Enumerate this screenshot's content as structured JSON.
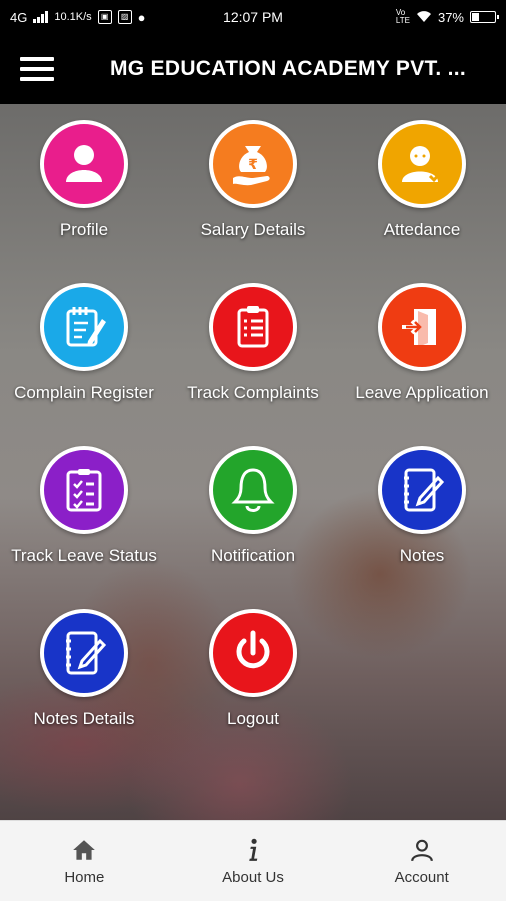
{
  "status_bar": {
    "network": "4G",
    "speed": "10.1K/s",
    "time": "12:07 PM",
    "volte": "VoLTE",
    "battery": "37%"
  },
  "app_bar": {
    "title": "MG EDUCATION ACADEMY PVT. ..."
  },
  "tiles": [
    {
      "label": "Profile",
      "color": "#e91e8c",
      "icon": "person-icon"
    },
    {
      "label": "Salary Details",
      "color": "#f57c1f",
      "icon": "rupee-bag-icon"
    },
    {
      "label": "Attedance",
      "color": "#f0a500",
      "icon": "attendance-user-icon"
    },
    {
      "label": "Complain Register",
      "color": "#1aa9e8",
      "icon": "notepad-pen-icon"
    },
    {
      "label": "Track Complaints",
      "color": "#e8151b",
      "icon": "clipboard-list-icon"
    },
    {
      "label": "Leave Application",
      "color": "#ef3c12",
      "icon": "exit-door-icon"
    },
    {
      "label": "Track Leave Status",
      "color": "#8b1fc8",
      "icon": "checklist-icon"
    },
    {
      "label": "Notification",
      "color": "#23a52b",
      "icon": "bell-icon"
    },
    {
      "label": "Notes",
      "color": "#1834c8",
      "icon": "notes-edit-icon"
    },
    {
      "label": "Notes Details",
      "color": "#1834c8",
      "icon": "notes-edit-icon"
    },
    {
      "label": "Logout",
      "color": "#e8151b",
      "icon": "power-icon"
    }
  ],
  "bottom_nav": [
    {
      "label": "Home",
      "icon": "home-icon"
    },
    {
      "label": "About Us",
      "icon": "info-icon"
    },
    {
      "label": "Account",
      "icon": "account-icon"
    }
  ]
}
